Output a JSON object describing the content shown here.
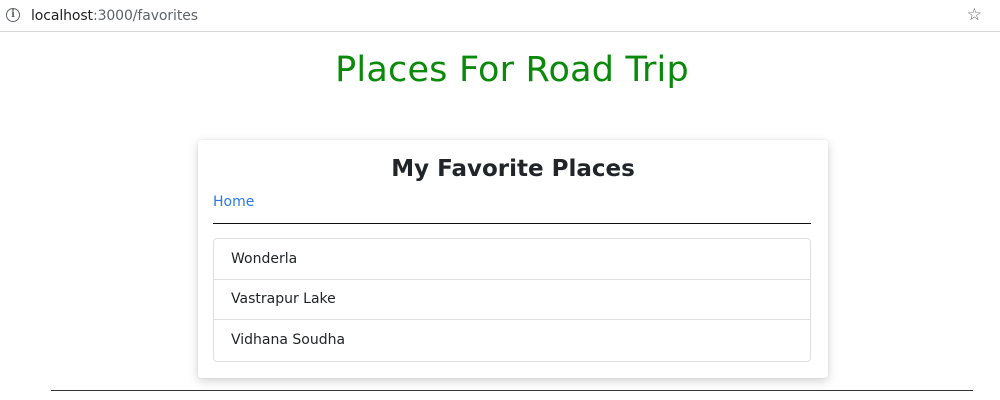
{
  "browser": {
    "url_host": "localhost",
    "url_path": ":3000/favorites",
    "info_icon": "info-icon",
    "bookmark_icon": "star-icon"
  },
  "page": {
    "title": "Places For Road Trip",
    "title_color": "#0a8a0a"
  },
  "card": {
    "title": "My Favorite Places",
    "home_link": "Home",
    "link_color": "#2a7ae2",
    "places": [
      "Wonderla",
      "Vastrapur Lake",
      "Vidhana Soudha"
    ]
  }
}
